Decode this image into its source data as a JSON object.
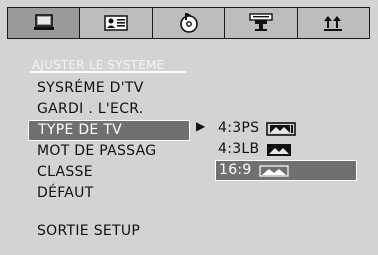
{
  "tabs": [
    {
      "name": "system",
      "icon": "monitor-icon",
      "active": true
    },
    {
      "name": "language",
      "icon": "id-card-icon",
      "active": false
    },
    {
      "name": "audio",
      "icon": "disc-icon",
      "active": false
    },
    {
      "name": "video",
      "icon": "projector-icon",
      "active": false
    },
    {
      "name": "preferences",
      "icon": "arrows-icon",
      "active": false
    }
  ],
  "section_title": "AJUSTER LE SYSTÈME",
  "menu": [
    {
      "label": "SYSRÉME D'TV"
    },
    {
      "label": "GARDI . L'ECR."
    },
    {
      "label": "TYPE DE TV",
      "selected": true
    },
    {
      "label": "MOT DE PASSAG"
    },
    {
      "label": "CLASSE"
    },
    {
      "label": "DÉFAUT"
    },
    {
      "label": "SORTIE SETUP"
    }
  ],
  "arrow": "▶",
  "tv_types": [
    {
      "label": "4:3PS",
      "icon": "pan-scan-icon"
    },
    {
      "label": "4:3LB",
      "icon": "letterbox-icon"
    },
    {
      "label": "16:9",
      "icon": "widescreen-icon",
      "selected": true
    }
  ]
}
